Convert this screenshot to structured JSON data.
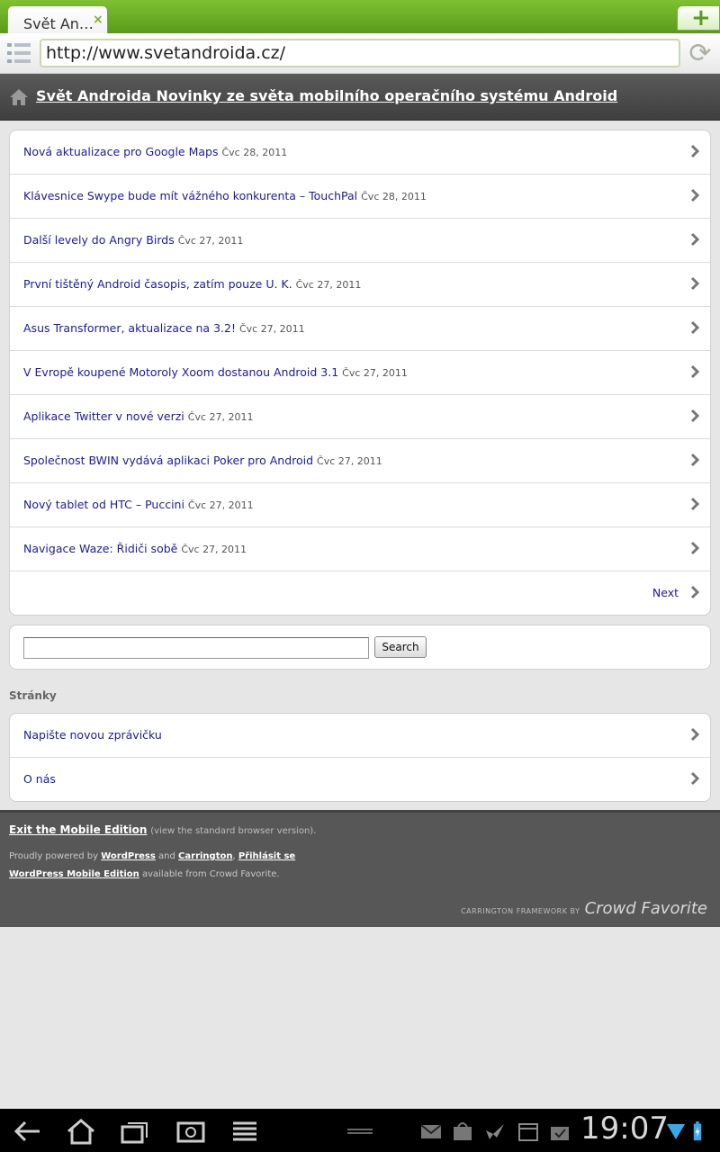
{
  "browser": {
    "tab_title": "Svět An…",
    "tab_close": "×",
    "new_tab": "+",
    "url": "http://www.svetandroida.cz/"
  },
  "site": {
    "title": "Svět Androida Novinky ze světa mobilního operačního systému Android"
  },
  "posts": [
    {
      "title": "Nová aktualizace pro Google Maps",
      "date": "Čvc 28, 2011"
    },
    {
      "title": "Klávesnice Swype bude mít vážného konkurenta – TouchPal",
      "date": "Čvc 28, 2011"
    },
    {
      "title": "Další levely do Angry Birds",
      "date": "Čvc 27, 2011"
    },
    {
      "title": "První tištěný Android časopis, zatím pouze U. K.",
      "date": "Čvc 27, 2011"
    },
    {
      "title": "Asus Transformer, aktualizace na 3.2!",
      "date": "Čvc 27, 2011"
    },
    {
      "title": "V Evropě koupené Motoroly Xoom dostanou Android 3.1",
      "date": "Čvc 27, 2011"
    },
    {
      "title": "Aplikace Twitter v nové verzi",
      "date": "Čvc 27, 2011"
    },
    {
      "title": "Společnost BWIN vydává aplikaci Poker pro Android",
      "date": "Čvc 27, 2011"
    },
    {
      "title": "Nový tablet od HTC – Puccini",
      "date": "Čvc 27, 2011"
    },
    {
      "title": "Navigace Waze: Řidiči sobě",
      "date": "Čvc 27, 2011"
    }
  ],
  "pagination": {
    "next_label": "Next"
  },
  "search": {
    "value": "",
    "button_label": "Search"
  },
  "pages": {
    "heading": "Stránky",
    "items": [
      {
        "label": "Napište novou zprávičku"
      },
      {
        "label": "O nás"
      }
    ]
  },
  "footer": {
    "exit_link": "Exit the Mobile Edition",
    "exit_note": "(view the standard browser version).",
    "powered_prefix": "Proudly powered by",
    "wordpress_link": "WordPress",
    "and_text": "and",
    "carrington_link": "Carrington",
    "login_link": "Přihlásit se",
    "wpme_link": "WordPress Mobile Edition",
    "available_text": "available from Crowd Favorite.",
    "cf_small": "CARRINGTON FRAMEWORK BY",
    "cf_big": "Crowd Favorite"
  },
  "status_bar": {
    "time": "19:07"
  },
  "colors": {
    "tab_green": "#6aad25",
    "link": "#1a1aa0",
    "header_dark": "#4a4a4a"
  }
}
